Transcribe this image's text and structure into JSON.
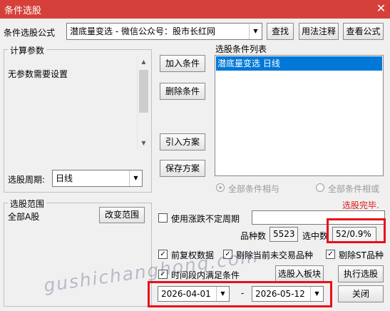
{
  "window": {
    "title": "条件选股",
    "close_glyph": "✕"
  },
  "formula": {
    "label": "条件选股公式",
    "selected": "潜底量变选  -  微信公众号：股市长红网",
    "find_label": "查找",
    "usage_label": "用法注释",
    "view_label": "查看公式"
  },
  "params": {
    "group_label": "计算参数",
    "no_params_text": "无参数需要设置",
    "period_label": "选股周期:",
    "period_value": "日线"
  },
  "actions": {
    "add_label": "加入条件",
    "delete_label": "删除条件",
    "import_label": "引入方案",
    "save_label": "保存方案"
  },
  "conditions": {
    "group_label": "选股条件列表",
    "items": [
      "潜底量变选  日线"
    ],
    "all_and_label": "全部条件相与",
    "all_or_label": "全部条件相或"
  },
  "status": {
    "done_text": "选股完毕.",
    "done_color": "#e01818"
  },
  "range": {
    "group_label": "选股范围",
    "scope_text": "全部A股",
    "change_label": "改变范围"
  },
  "options": {
    "variable_period_label": "使用涨跌不定周期",
    "variable_period_checked": false,
    "variety_count_label": "品种数",
    "variety_count": "5523",
    "selected_label": "选中数",
    "selected_value": "52/0.9%",
    "adjust_label": "前复权数据",
    "adjust_checked": true,
    "exclude_untraded_label": "剔除当前未交易品种",
    "exclude_untraded_checked": true,
    "exclude_st_label": "剔除ST品种",
    "exclude_st_checked": true,
    "time_range_label": "时间段内满足条件",
    "time_range_checked": true
  },
  "bottom": {
    "to_block_label": "选股入板块",
    "execute_label": "执行选股",
    "start_date": "2026-04-01",
    "date_sep": "-",
    "end_date": "2026-05-12",
    "close_label": "关闭"
  },
  "watermark": "gushichanghong.com",
  "highlight_color": "#e8101a"
}
